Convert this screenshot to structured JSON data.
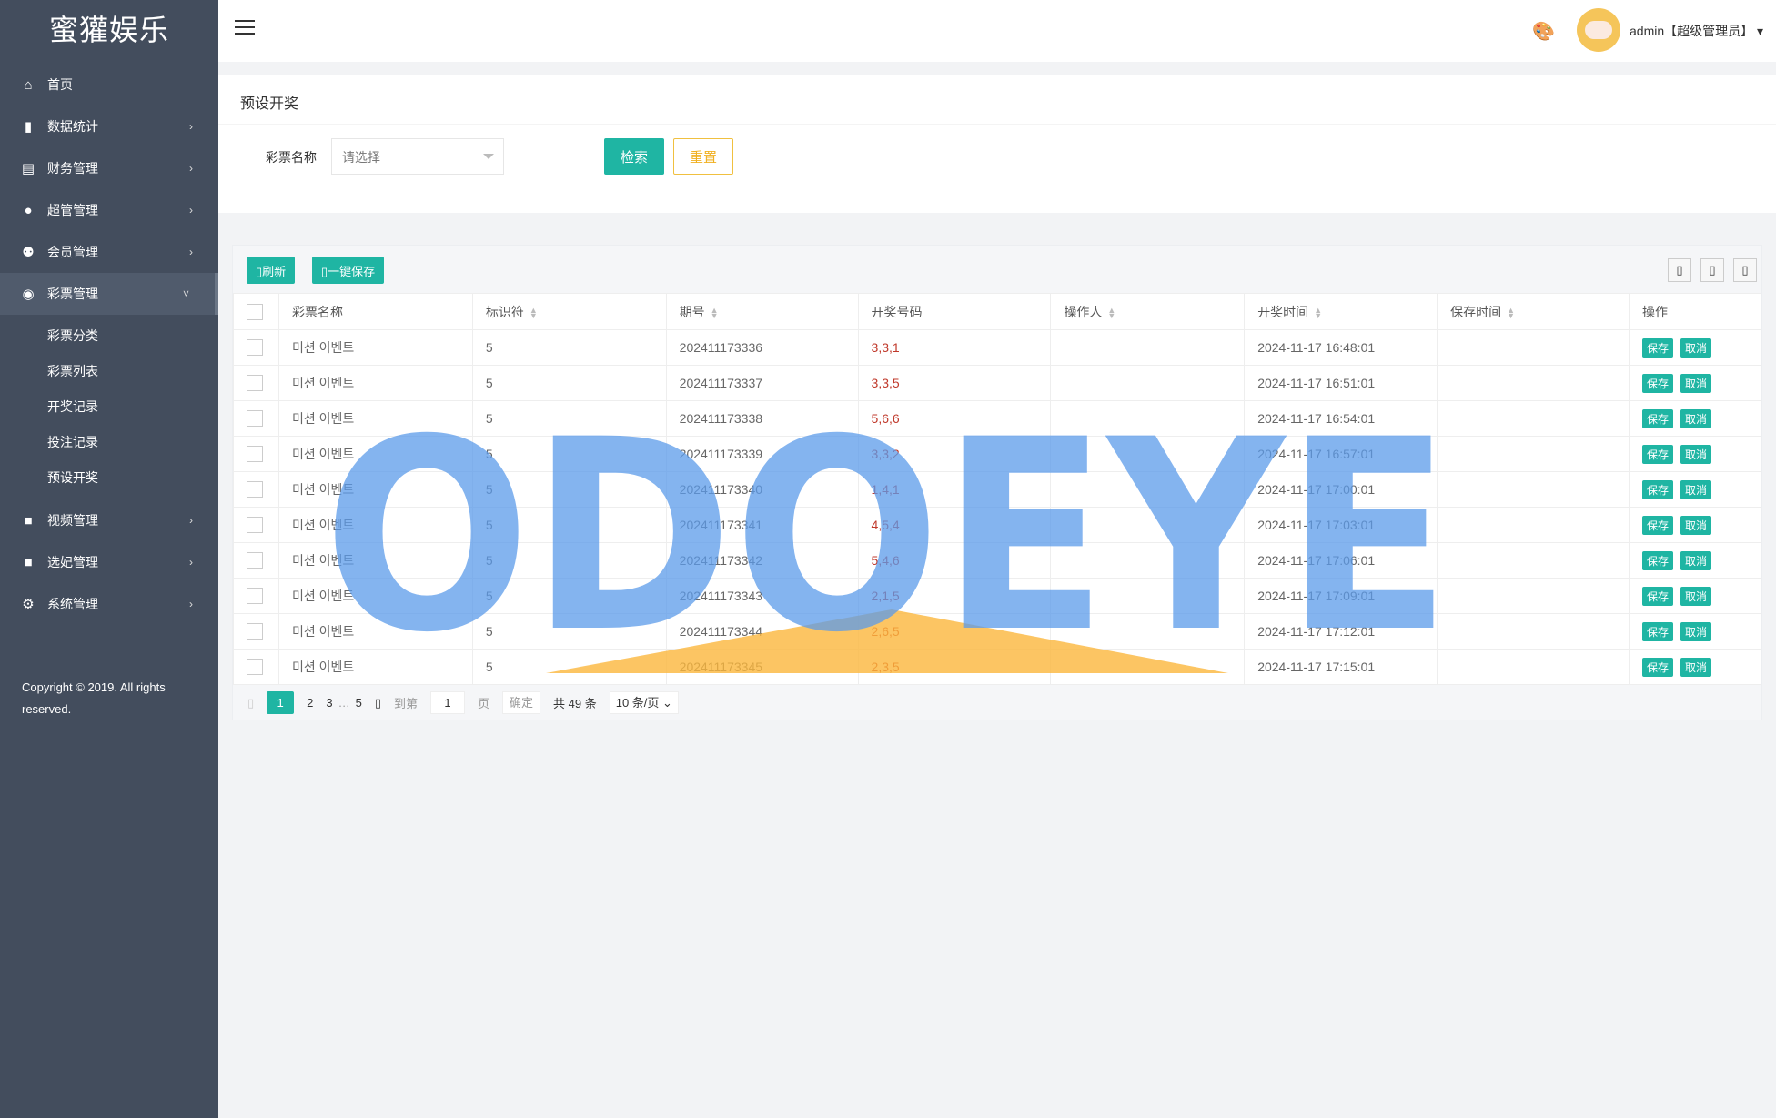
{
  "app": {
    "logo": "蜜獾娱乐",
    "copyright": "Copyright © 2019. All rights reserved."
  },
  "sidebar": {
    "items": [
      {
        "label": "首页",
        "icon": "home-icon"
      },
      {
        "label": "数据统计",
        "icon": "bar-chart-icon"
      },
      {
        "label": "财务管理",
        "icon": "bank-icon"
      },
      {
        "label": "超管管理",
        "icon": "user-icon"
      },
      {
        "label": "会员管理",
        "icon": "users-icon"
      },
      {
        "label": "彩票管理",
        "icon": "gamepad-icon",
        "active": true
      },
      {
        "label": "视频管理",
        "icon": "video-icon"
      },
      {
        "label": "选妃管理",
        "icon": "video-icon"
      },
      {
        "label": "系统管理",
        "icon": "gear-icon"
      }
    ],
    "subitems": [
      "彩票分类",
      "彩票列表",
      "开奖记录",
      "投注记录",
      "预设开奖"
    ]
  },
  "header": {
    "user": "admin【超级管理员】",
    "icons": [
      "menu-icon",
      "palette-icon"
    ]
  },
  "page": {
    "title": "预设开奖",
    "filter_label": "彩票名称",
    "select_placeholder": "请选择",
    "search": "检索",
    "reset": "重置"
  },
  "toolbar": {
    "refresh": "刷新",
    "save_all": "一键保存"
  },
  "table": {
    "headers": [
      "彩票名称",
      "标识符",
      "期号",
      "开奖号码",
      "操作人",
      "开奖时间",
      "保存时间",
      "操作"
    ],
    "save": "保存",
    "cancel": "取消",
    "rows": [
      [
        "미션 이벤트",
        "5",
        "202411173336",
        "3,3,1",
        "",
        "2024-11-17 16:48:01",
        ""
      ],
      [
        "미션 이벤트",
        "5",
        "202411173337",
        "3,3,5",
        "",
        "2024-11-17 16:51:01",
        ""
      ],
      [
        "미션 이벤트",
        "5",
        "202411173338",
        "5,6,6",
        "",
        "2024-11-17 16:54:01",
        ""
      ],
      [
        "미션 이벤트",
        "5",
        "202411173339",
        "3,3,2",
        "",
        "2024-11-17 16:57:01",
        ""
      ],
      [
        "미션 이벤트",
        "5",
        "202411173340",
        "1,4,1",
        "",
        "2024-11-17 17:00:01",
        ""
      ],
      [
        "미션 이벤트",
        "5",
        "202411173341",
        "4,5,4",
        "",
        "2024-11-17 17:03:01",
        ""
      ],
      [
        "미션 이벤트",
        "5",
        "202411173342",
        "5,4,6",
        "",
        "2024-11-17 17:06:01",
        ""
      ],
      [
        "미션 이벤트",
        "5",
        "202411173343",
        "2,1,5",
        "",
        "2024-11-17 17:09:01",
        ""
      ],
      [
        "미션 이벤트",
        "5",
        "202411173344",
        "2,6,5",
        "",
        "2024-11-17 17:12:01",
        ""
      ],
      [
        "미션 이벤트",
        "5",
        "202411173345",
        "2,3,5",
        "",
        "2024-11-17 17:15:01",
        ""
      ]
    ]
  },
  "pager": {
    "pages": [
      "1",
      "2",
      "3",
      "…",
      "5"
    ],
    "current": "1",
    "goto": "到第",
    "page_input": "1",
    "page_unit": "页",
    "confirm": "确定",
    "total": "共 49 条",
    "per_page": "10 条/页"
  },
  "watermark": "ODOEYE",
  "colors": {
    "sidebar": "#434d5d",
    "accent": "#1fb5a3",
    "warning": "#f0b020",
    "number": "#c0392b"
  }
}
